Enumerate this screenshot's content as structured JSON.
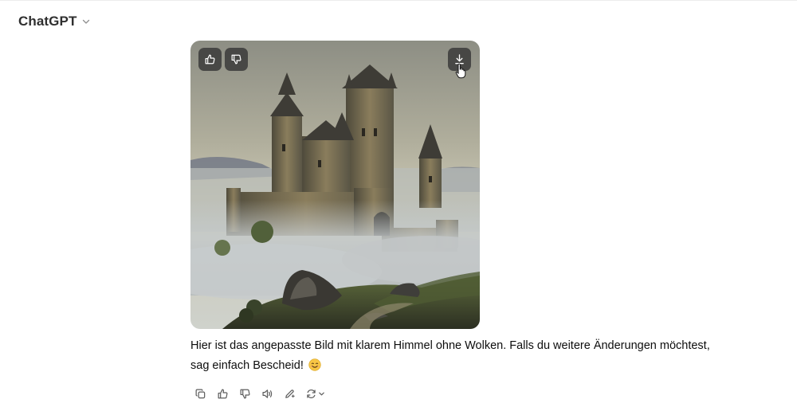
{
  "header": {
    "model_name": "ChatGPT",
    "chevron_icon": "chevron-down-icon"
  },
  "image_card": {
    "overlay_buttons": [
      {
        "icon": "thumbs-up-icon"
      },
      {
        "icon": "thumbs-down-icon"
      },
      {
        "icon": "download-icon"
      }
    ],
    "image_subject": "castle-in-fog-painting"
  },
  "message": {
    "line1": "Hier ist das angepasste Bild mit klarem Himmel ohne Wolken. Falls du weitere Änderungen möchtest,",
    "line2": "sag einfach Bescheid!",
    "emoji": "smiling-face-emoji"
  },
  "actions": [
    {
      "icon": "copy-icon"
    },
    {
      "icon": "thumbs-up-icon"
    },
    {
      "icon": "thumbs-down-icon"
    },
    {
      "icon": "read-aloud-icon"
    },
    {
      "icon": "edit-in-canvas-icon"
    },
    {
      "icon": "regenerate-icon"
    }
  ],
  "colors": {
    "text": "#0d0d0d",
    "icon": "#5d5d5d",
    "overlay_button": "#373737",
    "background": "#ffffff"
  }
}
